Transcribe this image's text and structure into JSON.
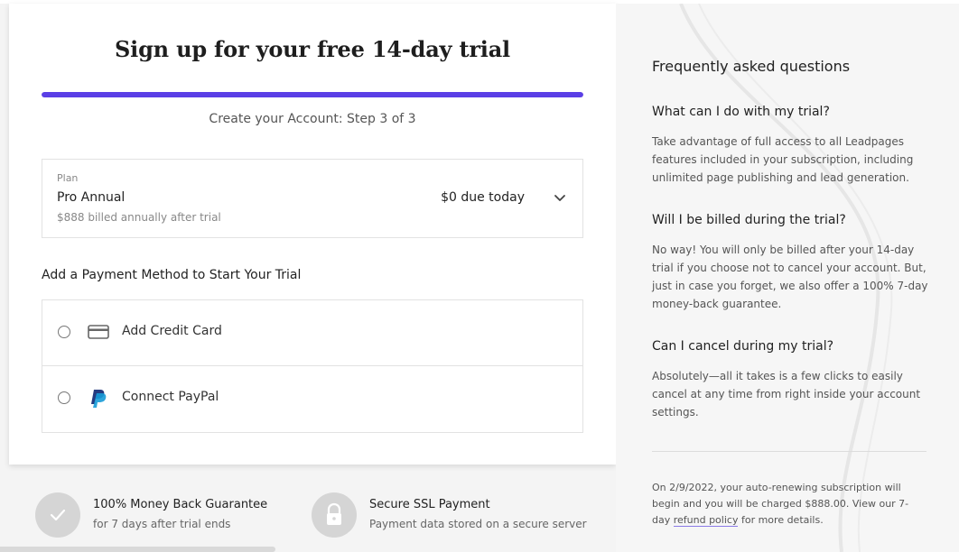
{
  "card": {
    "title": "Sign up for your free 14-day trial",
    "progress_fraction": 1.0,
    "step_text": "Create your Account: Step 3 of 3"
  },
  "plan": {
    "caption": "Plan",
    "name": "Pro Annual",
    "billing_note": "$888 billed annually after trial",
    "due_today": "$0 due today",
    "toggle_icon": "chevron-down-icon"
  },
  "payment": {
    "title": "Add a Payment Method to Start Your Trial",
    "options": [
      {
        "label": "Add Credit Card",
        "icon": "credit-card-icon"
      },
      {
        "label": "Connect PayPal",
        "icon": "paypal-icon"
      }
    ]
  },
  "badges": [
    {
      "title": "100% Money Back Guarantee",
      "subtitle": "for 7 days after trial ends",
      "icon": "check-icon"
    },
    {
      "title": "Secure SSL Payment",
      "subtitle": "Payment data stored on a secure server",
      "icon": "lock-icon"
    }
  ],
  "faq": {
    "title": "Frequently asked questions",
    "items": [
      {
        "question": "What can I do with my trial?",
        "answer": "Take advantage of full access to all Leadpages features included in your subscription, including unlimited page publishing and lead generation."
      },
      {
        "question": "Will I be billed during the trial?",
        "answer": "No way! You will only be billed after your 14-day trial if you choose not to cancel your account. But, just in case you forget, we also offer a 100% 7-day money-back guarantee."
      },
      {
        "question": "Can I cancel during my trial?",
        "answer": "Absolutely—all it takes is a few clicks to easily cancel at any time from right inside your account settings."
      }
    ]
  },
  "renewal": {
    "text_before": "On 2/9/2022, your auto-renewing subscription will begin and you will be charged $888.00. View our 7-day ",
    "link_text": "refund policy",
    "text_after": " for more details."
  },
  "colors": {
    "accent": "#5a3fe6",
    "paypal_dark": "#253b80",
    "paypal_light": "#179bd7"
  }
}
